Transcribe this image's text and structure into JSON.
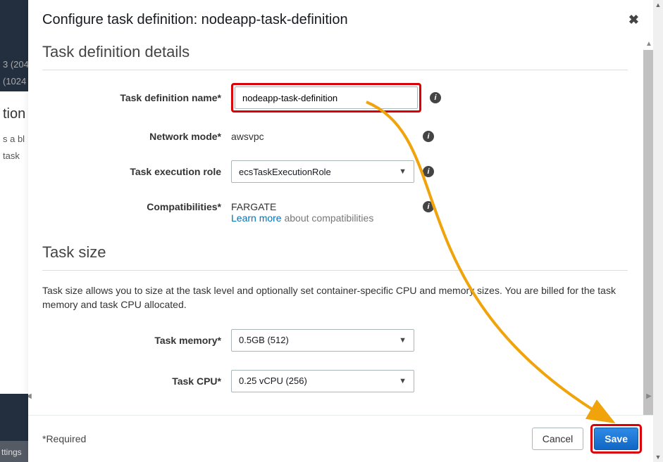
{
  "backdrop": {
    "line1": "3 (204",
    "line2": "(1024",
    "mid1": "tion",
    "mid2": "s a bl",
    "mid3": "task",
    "bottom": "ttings"
  },
  "modal": {
    "title": "Configure task definition: nodeapp-task-definition",
    "footer_required": "*Required",
    "cancel": "Cancel",
    "save": "Save"
  },
  "section_details": {
    "title": "Task definition details",
    "name_label": "Task definition name*",
    "name_value": "nodeapp-task-definition",
    "network_label": "Network mode*",
    "network_value": "awsvpc",
    "exec_role_label": "Task execution role",
    "exec_role_value": "ecsTaskExecutionRole",
    "compat_label": "Compatibilities*",
    "compat_value": "FARGATE",
    "learn_more": "Learn more",
    "learn_more_suffix": " about compatibilities"
  },
  "section_size": {
    "title": "Task size",
    "description": "Task size allows you to size at the task level and optionally set container-specific CPU and memory sizes. You are billed for the task memory and task CPU allocated.",
    "memory_label": "Task memory*",
    "memory_value": "0.5GB (512)",
    "cpu_label": "Task CPU*",
    "cpu_value": "0.25 vCPU (256)"
  },
  "icons": {
    "info": "i"
  }
}
